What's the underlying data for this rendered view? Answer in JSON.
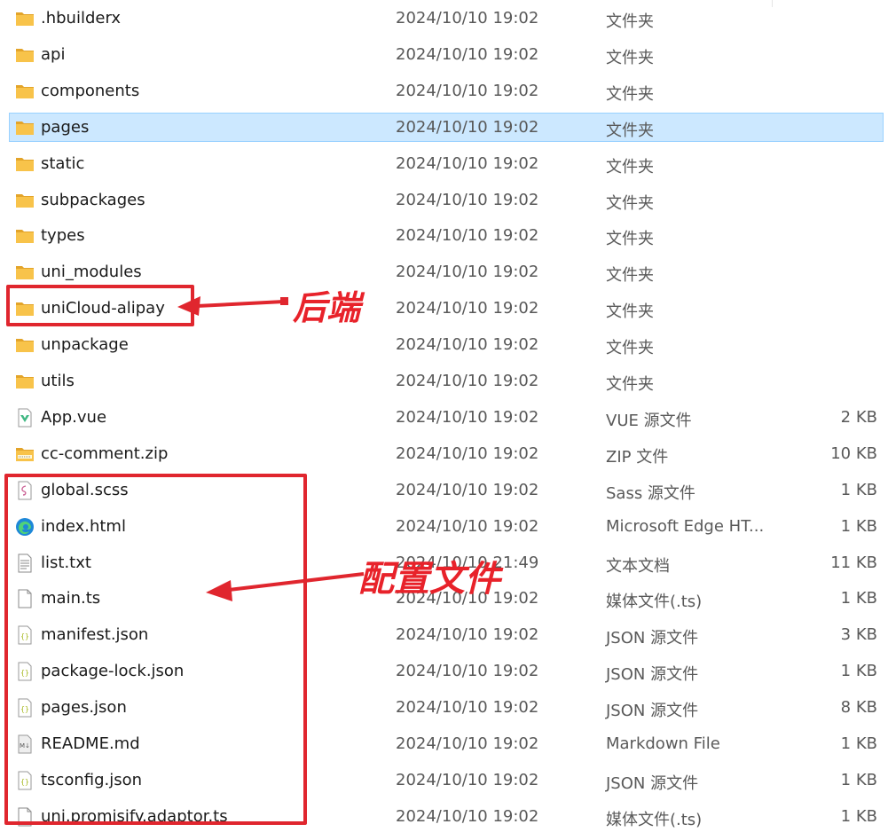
{
  "files": [
    {
      "name": ".hbuilderx",
      "date": "2024/10/10 19:02",
      "type": "文件夹",
      "size": "",
      "icon": "folder-icon"
    },
    {
      "name": "api",
      "date": "2024/10/10 19:02",
      "type": "文件夹",
      "size": "",
      "icon": "folder-icon"
    },
    {
      "name": "components",
      "date": "2024/10/10 19:02",
      "type": "文件夹",
      "size": "",
      "icon": "folder-icon"
    },
    {
      "name": "pages",
      "date": "2024/10/10 19:02",
      "type": "文件夹",
      "size": "",
      "icon": "folder-icon",
      "selected": true
    },
    {
      "name": "static",
      "date": "2024/10/10 19:02",
      "type": "文件夹",
      "size": "",
      "icon": "folder-icon"
    },
    {
      "name": "subpackages",
      "date": "2024/10/10 19:02",
      "type": "文件夹",
      "size": "",
      "icon": "folder-icon"
    },
    {
      "name": "types",
      "date": "2024/10/10 19:02",
      "type": "文件夹",
      "size": "",
      "icon": "folder-icon"
    },
    {
      "name": "uni_modules",
      "date": "2024/10/10 19:02",
      "type": "文件夹",
      "size": "",
      "icon": "folder-icon"
    },
    {
      "name": "uniCloud-alipay",
      "date": "2024/10/10 19:02",
      "type": "文件夹",
      "size": "",
      "icon": "folder-icon"
    },
    {
      "name": "unpackage",
      "date": "2024/10/10 19:02",
      "type": "文件夹",
      "size": "",
      "icon": "folder-icon"
    },
    {
      "name": "utils",
      "date": "2024/10/10 19:02",
      "type": "文件夹",
      "size": "",
      "icon": "folder-icon"
    },
    {
      "name": "App.vue",
      "date": "2024/10/10 19:02",
      "type": "VUE 源文件",
      "size": "2 KB",
      "icon": "vue-file-icon"
    },
    {
      "name": "cc-comment.zip",
      "date": "2024/10/10 19:02",
      "type": "ZIP 文件",
      "size": "10 KB",
      "icon": "zip-folder-icon"
    },
    {
      "name": "global.scss",
      "date": "2024/10/10 19:02",
      "type": "Sass 源文件",
      "size": "1 KB",
      "icon": "sass-file-icon"
    },
    {
      "name": "index.html",
      "date": "2024/10/10 19:02",
      "type": "Microsoft Edge HT...",
      "size": "1 KB",
      "icon": "edge-icon"
    },
    {
      "name": "list.txt",
      "date": "2024/10/10 21:49",
      "type": "文本文档",
      "size": "11 KB",
      "icon": "text-file-icon"
    },
    {
      "name": "main.ts",
      "date": "2024/10/10 19:02",
      "type": "媒体文件(.ts)",
      "size": "1 KB",
      "icon": "media-file-icon"
    },
    {
      "name": "manifest.json",
      "date": "2024/10/10 19:02",
      "type": "JSON 源文件",
      "size": "3 KB",
      "icon": "json-file-icon"
    },
    {
      "name": "package-lock.json",
      "date": "2024/10/10 19:02",
      "type": "JSON 源文件",
      "size": "1 KB",
      "icon": "json-file-icon"
    },
    {
      "name": "pages.json",
      "date": "2024/10/10 19:02",
      "type": "JSON 源文件",
      "size": "8 KB",
      "icon": "json-file-icon"
    },
    {
      "name": "README.md",
      "date": "2024/10/10 19:02",
      "type": "Markdown File",
      "size": "1 KB",
      "icon": "markdown-file-icon"
    },
    {
      "name": "tsconfig.json",
      "date": "2024/10/10 19:02",
      "type": "JSON 源文件",
      "size": "1 KB",
      "icon": "json-file-icon"
    },
    {
      "name": "uni.promisify.adaptor.ts",
      "date": "2024/10/10 19:02",
      "type": "媒体文件(.ts)",
      "size": "1 KB",
      "icon": "media-file-icon"
    }
  ],
  "annotations": {
    "backend_label": "后端",
    "config_label": "配置文件",
    "color": "#e0262e"
  },
  "colors": {
    "selection_bg": "#cce8ff",
    "selection_border": "#99d1ff",
    "folder": "#f8c34a"
  }
}
